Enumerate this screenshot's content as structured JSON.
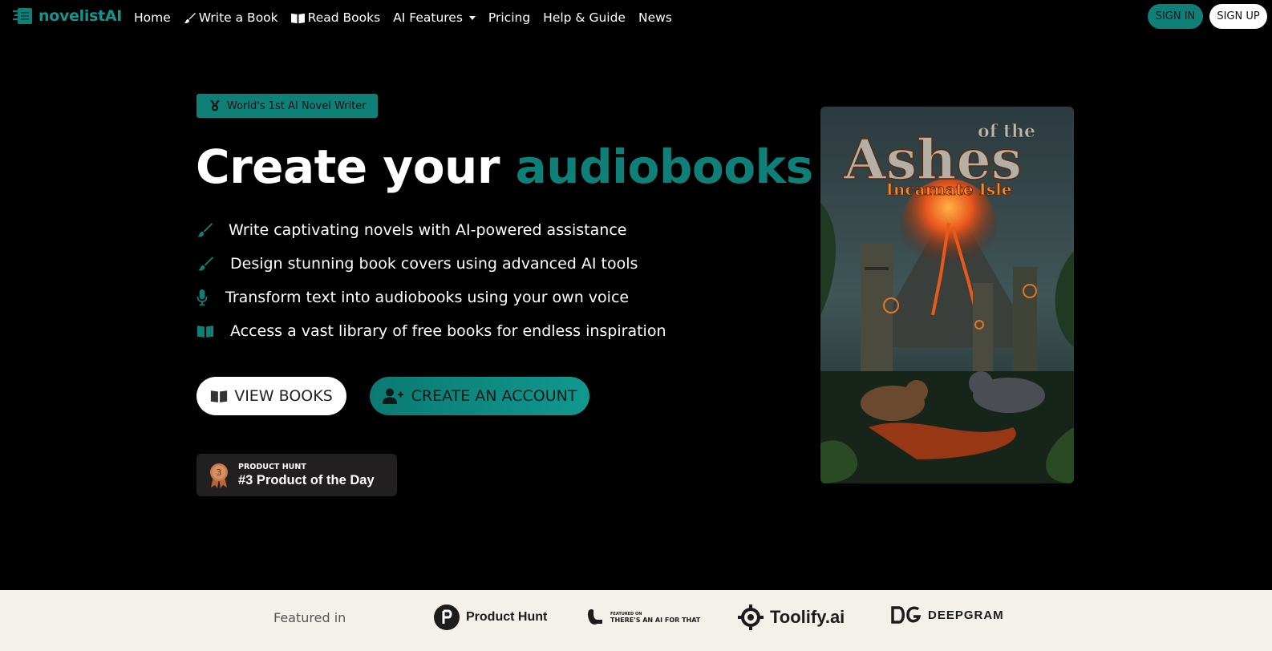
{
  "nav": {
    "brand": "novelistAI",
    "links": {
      "home": "Home",
      "write": "Write a Book",
      "read": "Read Books",
      "ai_features": "AI Features",
      "pricing": "Pricing",
      "help": "Help & Guide",
      "news": "News"
    },
    "sign_in": "SIGN IN",
    "sign_up": "SIGN UP"
  },
  "hero": {
    "badge": "World's 1st AI Novel Writer",
    "headline_prefix": "Create your",
    "headline_accent": "audiobooks",
    "features": [
      {
        "icon": "brush-icon",
        "text": "Write captivating novels with AI-powered assistance"
      },
      {
        "icon": "brush-icon",
        "text": "Design stunning book covers using advanced AI tools"
      },
      {
        "icon": "microphone-icon",
        "text": "Transform text into audiobooks using your own voice"
      },
      {
        "icon": "open-book-icon",
        "text": "Access a vast library of free books for endless inspiration"
      }
    ],
    "view_books": "VIEW BOOKS",
    "create_account": "CREATE AN ACCOUNT",
    "product_hunt": {
      "rank": "3",
      "label": "PRODUCT HUNT",
      "title": "#3 Product of the Day"
    }
  },
  "cover": {
    "title_small": "of the",
    "title_main": "Ashes",
    "subtitle": "Incarnate Isle"
  },
  "featured": {
    "label": "Featured in",
    "logos": {
      "product_hunt": "Product Hunt",
      "taaft_small": "FEATURED ON",
      "taaft_main": "THERE'S AN AI FOR THAT",
      "toolify": "Toolify.ai",
      "deepgram": "DEEPGRAM"
    }
  },
  "colors": {
    "accent": "#0e8078",
    "background": "#000000",
    "featured_bg": "#f3f1ea"
  }
}
